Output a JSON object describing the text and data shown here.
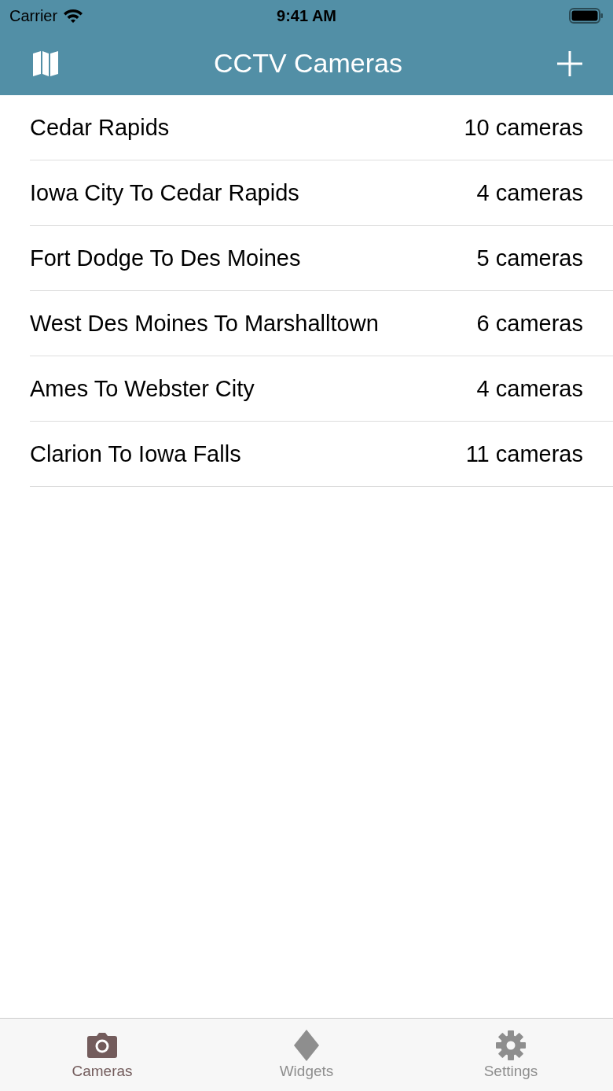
{
  "status_bar": {
    "carrier": "Carrier",
    "time": "9:41 AM"
  },
  "nav_bar": {
    "title": "CCTV Cameras"
  },
  "routes": [
    {
      "name": "Cedar Rapids",
      "count": "10 cameras"
    },
    {
      "name": "Iowa City To Cedar Rapids",
      "count": "4 cameras"
    },
    {
      "name": "Fort Dodge To Des Moines",
      "count": "5 cameras"
    },
    {
      "name": "West Des Moines To Marshalltown",
      "count": "6 cameras"
    },
    {
      "name": "Ames To Webster City",
      "count": "4 cameras"
    },
    {
      "name": "Clarion To Iowa Falls",
      "count": "11 cameras"
    }
  ],
  "tab_bar": [
    {
      "label": "Cameras",
      "kind": "camera",
      "selected": true
    },
    {
      "label": "Widgets",
      "kind": "diamond",
      "selected": false
    },
    {
      "label": "Settings",
      "kind": "gear",
      "selected": false
    }
  ]
}
